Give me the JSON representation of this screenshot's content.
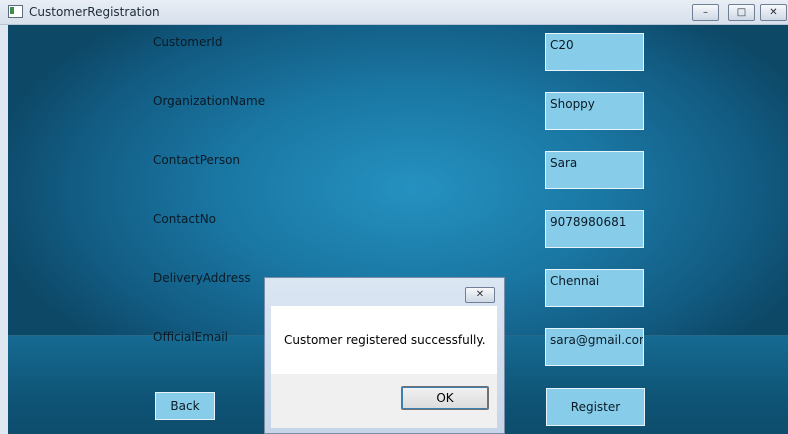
{
  "window": {
    "title": "CustomerRegistration",
    "controls": {
      "minimize": "–",
      "maximize": "□",
      "close": "✕"
    }
  },
  "form": {
    "fields": [
      {
        "label": "CustomerId",
        "value": "C20"
      },
      {
        "label": "OrganizationName",
        "value": "Shoppy"
      },
      {
        "label": "ContactPerson",
        "value": "Sara"
      },
      {
        "label": "ContactNo",
        "value": "9078980681"
      },
      {
        "label": "DeliveryAddress",
        "value": "Chennai"
      },
      {
        "label": "OfficialEmail",
        "value": "sara@gmail.com"
      }
    ],
    "back_label": "Back",
    "register_label": "Register"
  },
  "dialog": {
    "message": "Customer registered successfully.",
    "ok_label": "OK",
    "close_glyph": "✕"
  },
  "colors": {
    "background": "#1a77a3",
    "field_fill": "#87cdea"
  }
}
